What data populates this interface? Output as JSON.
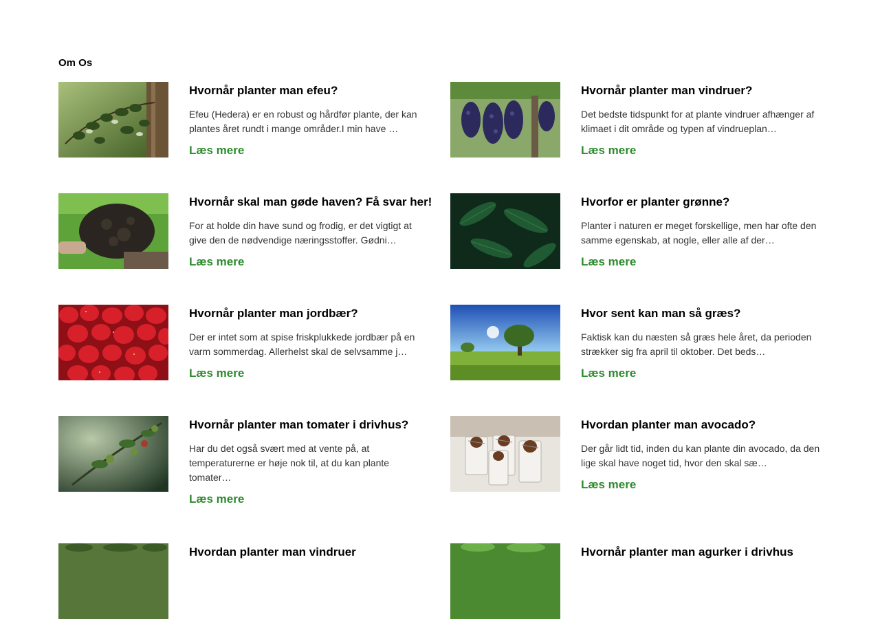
{
  "section": {
    "title": "Om Os"
  },
  "left_articles": [
    {
      "title": "Hvornår planter man efeu?",
      "excerpt": "Efeu (Hedera) er en robust og hårdfør plante, der kan plantes året rundt i mange områder.I min have …",
      "read_more": "Læs mere",
      "image_icon": "ivy-image"
    },
    {
      "title": "Hvornår skal man gøde haven? Få svar her!",
      "excerpt": "For at holde din have sund og frodig, er det vigtigt at give den de nødvendige næringsstoffer. Gødni…",
      "read_more": "Læs mere",
      "image_icon": "compost-image"
    },
    {
      "title": "Hvornår planter man jordbær?",
      "excerpt": "Der er intet som at spise friskplukkede jordbær på en varm sommerdag. Allerhelst skal de selvsamme j…",
      "read_more": "Læs mere",
      "image_icon": "strawberries-image"
    },
    {
      "title": "Hvornår planter man tomater i drivhus?",
      "excerpt": "Har du det også svært med at vente på, at temperaturerne er høje nok til, at du kan plante tomater…",
      "read_more": "Læs mere",
      "image_icon": "tomato-plant-image"
    },
    {
      "title": "Hvordan planter man vindruer",
      "excerpt": "",
      "read_more": "",
      "image_icon": "grapevine-image"
    }
  ],
  "right_articles": [
    {
      "title": "Hvornår planter man vindruer?",
      "excerpt": "Det bedste tidspunkt for at plante vindruer afhænger af klimaet i dit område og typen af vindrueplan…",
      "read_more": "Læs mere",
      "image_icon": "grapes-image"
    },
    {
      "title": "Hvorfor er planter grønne?",
      "excerpt": "Planter i naturen er meget forskellige, men har ofte den samme egenskab, at nogle, eller alle af der…",
      "read_more": "Læs mere",
      "image_icon": "green-leaves-image"
    },
    {
      "title": "Hvor sent kan man så græs?",
      "excerpt": "Faktisk kan du næsten så græs hele året, da perioden strækker sig fra april til oktober. Det beds…",
      "read_more": "Læs mere",
      "image_icon": "lawn-tree-image"
    },
    {
      "title": "Hvordan planter man avocado?",
      "excerpt": "Der går lidt tid, inden du kan plante din avocado, da den lige skal have noget tid, hvor den skal sæ…",
      "read_more": "Læs mere",
      "image_icon": "avocado-glasses-image"
    },
    {
      "title": "Hvornår planter man agurker i drivhus",
      "excerpt": "",
      "read_more": "",
      "image_icon": "cucumber-leaves-image"
    }
  ],
  "colors": {
    "link_green": "#2e8b2e"
  }
}
